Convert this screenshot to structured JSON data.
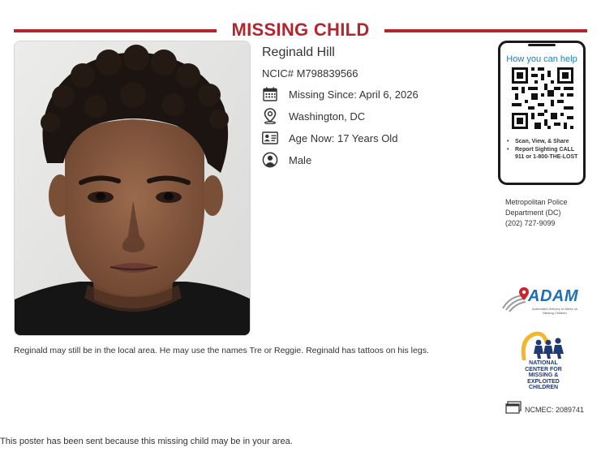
{
  "header": {
    "title": "MISSING CHILD"
  },
  "child": {
    "name": "Reginald Hill",
    "ncic": "NCIC# M798839566",
    "missing_since": "Missing Since: April 6, 2026",
    "location": "Washington, DC",
    "age": "Age Now: 17 Years Old",
    "sex": "Male",
    "description": "Reginald may still be in the local area. He may use the names Tre or Reggie. Reginald has tattoos on his legs."
  },
  "help_panel": {
    "title": "How you can help",
    "items": [
      "Scan, View, & Share",
      "Report Sighting CALL 911 or 1-800-THE-LOST"
    ]
  },
  "agency": {
    "line1": "Metropolitan Police",
    "line2": "Department (DC)",
    "phone": "(202) 727-9099"
  },
  "logos": {
    "adam": "ADAM",
    "adam_tagline": "Automated Delivery of Alerts on Missing Children",
    "ncmec": "NATIONAL CENTER FOR MISSING & EXPLOITED CHILDREN"
  },
  "case_number": "NCMEC: 2089741",
  "footer": "This poster has been sent because this missing child may be in your area.",
  "colors": {
    "accent": "#b3262d",
    "link": "#1a7fc1",
    "text": "#333333"
  },
  "icons": [
    "calendar-icon",
    "map-pin-icon",
    "id-card-icon",
    "person-icon",
    "qr-code-icon",
    "folders-icon"
  ]
}
